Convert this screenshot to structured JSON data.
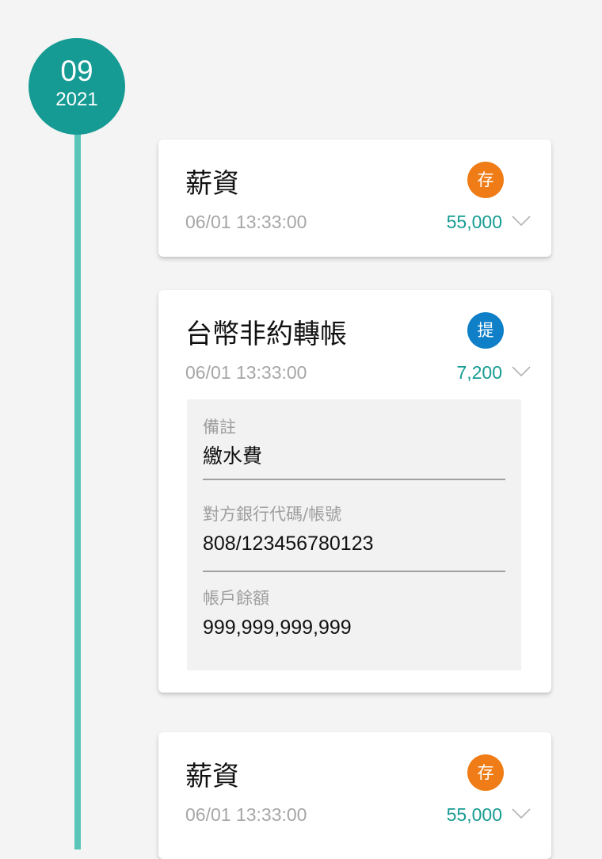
{
  "date_badge": {
    "month": "09",
    "year": "2021"
  },
  "colors": {
    "teal": "#159b93",
    "timeline": "#5ac6b9",
    "deposit_badge": "#ef7c16",
    "withdraw_badge": "#0f7fc8",
    "amount": "#169c92"
  },
  "transactions": [
    {
      "title": "薪資",
      "type_badge": "存",
      "type_icon": "deposit-badge",
      "datetime": "06/01 13:33:00",
      "amount": "55,000",
      "expanded": false
    },
    {
      "title": "台幣非約轉帳",
      "type_badge": "提",
      "type_icon": "withdraw-badge",
      "datetime": "06/01 13:33:00",
      "amount": "7,200",
      "expanded": true,
      "details": [
        {
          "label": "備註",
          "value": "繳水費"
        },
        {
          "label": "對方銀行代碼/帳號",
          "value": "808/123456780123"
        },
        {
          "label": "帳戶餘額",
          "value": "999,999,999,999"
        }
      ]
    },
    {
      "title": "薪資",
      "type_badge": "存",
      "type_icon": "deposit-badge",
      "datetime": "06/01 13:33:00",
      "amount": "55,000",
      "expanded": false
    }
  ]
}
